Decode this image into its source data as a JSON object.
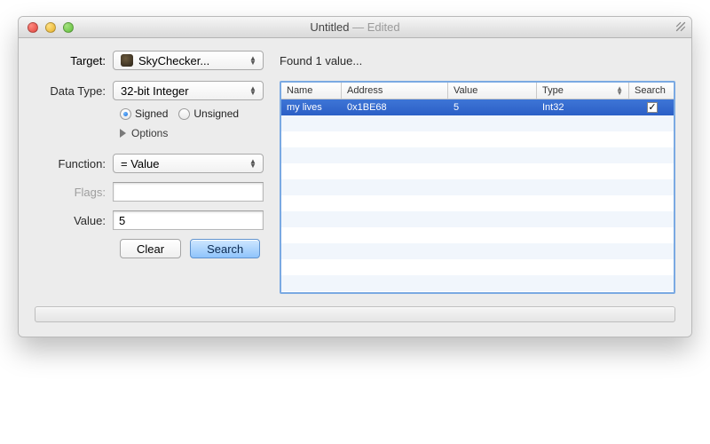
{
  "window": {
    "title": "Untitled",
    "edited_suffix": " — Edited"
  },
  "top": {
    "target_label": "Target:",
    "target_value": "SkyChecker...",
    "found_text": "Found 1 value..."
  },
  "form": {
    "datatype_label": "Data Type:",
    "datatype_value": "32-bit Integer",
    "signed_label": "Signed",
    "unsigned_label": "Unsigned",
    "options_label": "Options",
    "function_label": "Function:",
    "function_value": "= Value",
    "flags_label": "Flags:",
    "flags_value": "",
    "value_label": "Value:",
    "value_value": "5",
    "clear_label": "Clear",
    "search_label": "Search"
  },
  "table": {
    "columns": {
      "name": "Name",
      "address": "Address",
      "value": "Value",
      "type": "Type",
      "search": "Search"
    },
    "rows": [
      {
        "name": "my lives",
        "address": "0x1BE68",
        "value": "5",
        "type": "Int32",
        "search_checked": true
      }
    ]
  }
}
